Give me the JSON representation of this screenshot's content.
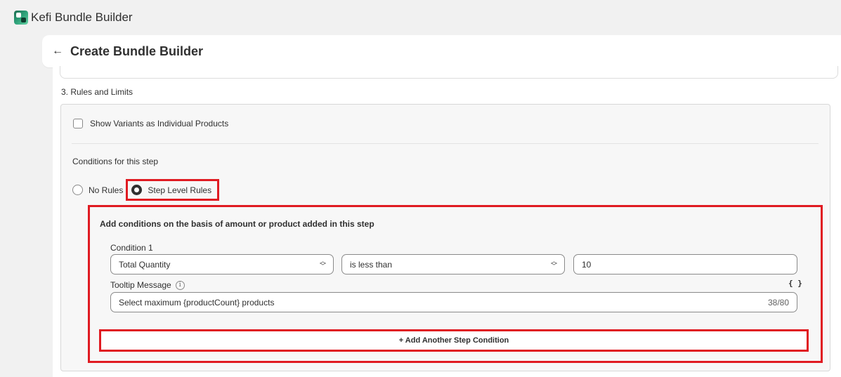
{
  "app": {
    "name": "Kefi Bundle Builder",
    "logo_icon": "kefi-logo-icon"
  },
  "header": {
    "back_icon": "←",
    "title": "Create Bundle Builder"
  },
  "section": {
    "title": "3. Rules and Limits",
    "show_variants_label": "Show Variants as Individual Products",
    "show_variants_checked": false,
    "conditions_heading": "Conditions for this step",
    "radio_options": [
      {
        "label": "No Rules",
        "selected": false
      },
      {
        "label": "Step Level Rules",
        "selected": true
      }
    ]
  },
  "conditions": {
    "heading": "Add conditions on the basis of amount or product added in this step",
    "items": [
      {
        "label": "Condition 1",
        "metric": "Total Quantity",
        "operator": "is less than",
        "value": "10"
      }
    ],
    "tooltip_label": "Tooltip Message",
    "tooltip_info_icon": "ⓘ",
    "braces_icon": "{ }",
    "tooltip_value": "Select maximum {productCount} products",
    "char_count": "38/80",
    "add_button_label": "+ Add Another Step Condition"
  },
  "colors": {
    "highlight": "#e01b22",
    "page_bg": "#f1f1f1",
    "panel_bg": "#f7f7f7"
  }
}
